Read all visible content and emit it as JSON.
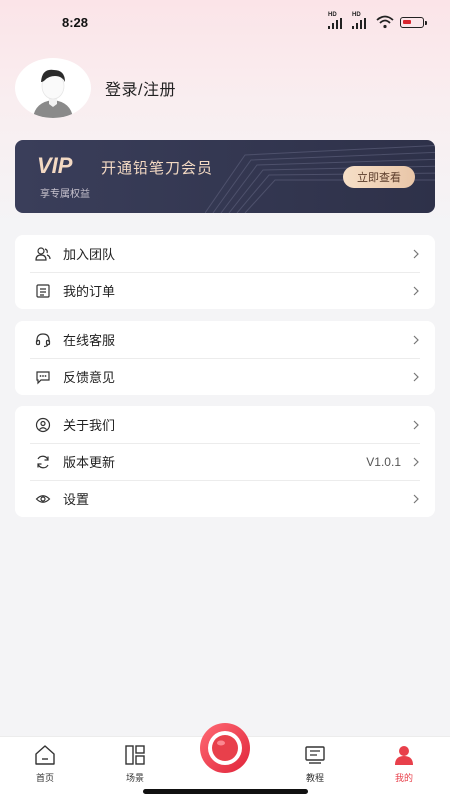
{
  "status_bar": {
    "time": "8:28",
    "hd1": "HD",
    "hd2": "HD"
  },
  "profile": {
    "login_label": "登录/注册"
  },
  "vip": {
    "logo": "VIP",
    "title": "开通铅笔刀会员",
    "subtitle": "享专属权益",
    "button": "立即查看"
  },
  "menu_groups": [
    {
      "items": [
        {
          "icon": "team-icon",
          "label": "加入团队",
          "value": ""
        },
        {
          "icon": "order-icon",
          "label": "我的订单",
          "value": ""
        }
      ]
    },
    {
      "items": [
        {
          "icon": "headset-icon",
          "label": "在线客服",
          "value": ""
        },
        {
          "icon": "feedback-icon",
          "label": "反馈意见",
          "value": ""
        }
      ]
    },
    {
      "items": [
        {
          "icon": "about-icon",
          "label": "关于我们",
          "value": ""
        },
        {
          "icon": "refresh-icon",
          "label": "版本更新",
          "value": "V1.0.1"
        },
        {
          "icon": "settings-icon",
          "label": "设置",
          "value": ""
        }
      ]
    }
  ],
  "tabbar": {
    "tabs": [
      {
        "icon": "home-icon",
        "label": "首页",
        "active": false
      },
      {
        "icon": "scene-icon",
        "label": "场景",
        "active": false
      },
      {
        "icon": "tutorial-icon",
        "label": "教程",
        "active": false
      },
      {
        "icon": "profile-icon",
        "label": "我的",
        "active": true
      }
    ],
    "record_icon": "record-icon"
  },
  "colors": {
    "accent": "#e8404b",
    "vip_bg": "#353852",
    "vip_gold": "#f3d9c3",
    "page_bg": "#f4f4f6"
  }
}
